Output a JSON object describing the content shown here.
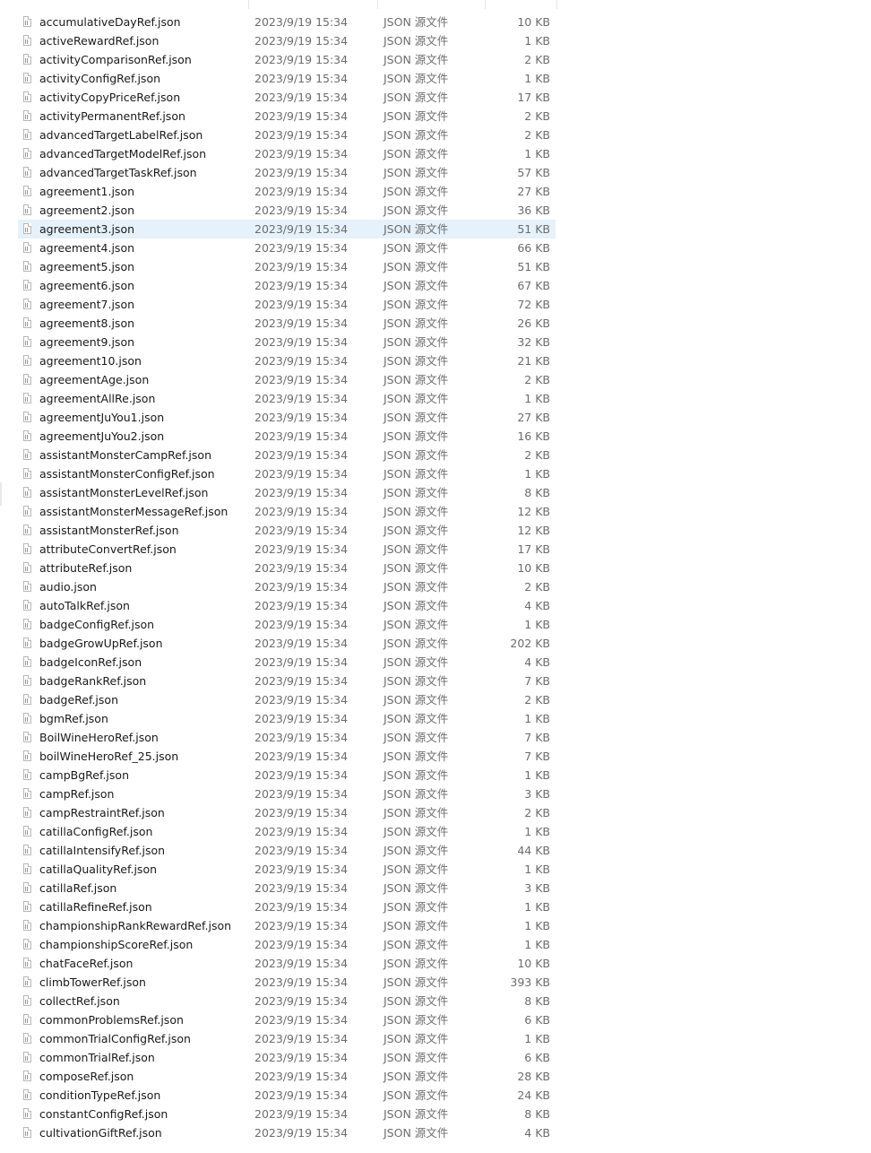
{
  "files": [
    {
      "name": "accumulativeDayRef.json",
      "date": "2023/9/19 15:34",
      "type": "JSON 源文件",
      "size": "10 KB"
    },
    {
      "name": "activeRewardRef.json",
      "date": "2023/9/19 15:34",
      "type": "JSON 源文件",
      "size": "1 KB"
    },
    {
      "name": "activityComparisonRef.json",
      "date": "2023/9/19 15:34",
      "type": "JSON 源文件",
      "size": "2 KB"
    },
    {
      "name": "activityConfigRef.json",
      "date": "2023/9/19 15:34",
      "type": "JSON 源文件",
      "size": "1 KB"
    },
    {
      "name": "activityCopyPriceRef.json",
      "date": "2023/9/19 15:34",
      "type": "JSON 源文件",
      "size": "17 KB"
    },
    {
      "name": "activityPermanentRef.json",
      "date": "2023/9/19 15:34",
      "type": "JSON 源文件",
      "size": "2 KB"
    },
    {
      "name": "advancedTargetLabelRef.json",
      "date": "2023/9/19 15:34",
      "type": "JSON 源文件",
      "size": "2 KB"
    },
    {
      "name": "advancedTargetModelRef.json",
      "date": "2023/9/19 15:34",
      "type": "JSON 源文件",
      "size": "1 KB"
    },
    {
      "name": "advancedTargetTaskRef.json",
      "date": "2023/9/19 15:34",
      "type": "JSON 源文件",
      "size": "57 KB"
    },
    {
      "name": "agreement1.json",
      "date": "2023/9/19 15:34",
      "type": "JSON 源文件",
      "size": "27 KB"
    },
    {
      "name": "agreement2.json",
      "date": "2023/9/19 15:34",
      "type": "JSON 源文件",
      "size": "36 KB"
    },
    {
      "name": "agreement3.json",
      "date": "2023/9/19 15:34",
      "type": "JSON 源文件",
      "size": "51 KB",
      "selected": true
    },
    {
      "name": "agreement4.json",
      "date": "2023/9/19 15:34",
      "type": "JSON 源文件",
      "size": "66 KB"
    },
    {
      "name": "agreement5.json",
      "date": "2023/9/19 15:34",
      "type": "JSON 源文件",
      "size": "51 KB"
    },
    {
      "name": "agreement6.json",
      "date": "2023/9/19 15:34",
      "type": "JSON 源文件",
      "size": "67 KB"
    },
    {
      "name": "agreement7.json",
      "date": "2023/9/19 15:34",
      "type": "JSON 源文件",
      "size": "72 KB"
    },
    {
      "name": "agreement8.json",
      "date": "2023/9/19 15:34",
      "type": "JSON 源文件",
      "size": "26 KB"
    },
    {
      "name": "agreement9.json",
      "date": "2023/9/19 15:34",
      "type": "JSON 源文件",
      "size": "32 KB"
    },
    {
      "name": "agreement10.json",
      "date": "2023/9/19 15:34",
      "type": "JSON 源文件",
      "size": "21 KB"
    },
    {
      "name": "agreementAge.json",
      "date": "2023/9/19 15:34",
      "type": "JSON 源文件",
      "size": "2 KB"
    },
    {
      "name": "agreementAllRe.json",
      "date": "2023/9/19 15:34",
      "type": "JSON 源文件",
      "size": "1 KB"
    },
    {
      "name": "agreementJuYou1.json",
      "date": "2023/9/19 15:34",
      "type": "JSON 源文件",
      "size": "27 KB"
    },
    {
      "name": "agreementJuYou2.json",
      "date": "2023/9/19 15:34",
      "type": "JSON 源文件",
      "size": "16 KB"
    },
    {
      "name": "assistantMonsterCampRef.json",
      "date": "2023/9/19 15:34",
      "type": "JSON 源文件",
      "size": "2 KB"
    },
    {
      "name": "assistantMonsterConfigRef.json",
      "date": "2023/9/19 15:34",
      "type": "JSON 源文件",
      "size": "1 KB"
    },
    {
      "name": "assistantMonsterLevelRef.json",
      "date": "2023/9/19 15:34",
      "type": "JSON 源文件",
      "size": "8 KB"
    },
    {
      "name": "assistantMonsterMessageRef.json",
      "date": "2023/9/19 15:34",
      "type": "JSON 源文件",
      "size": "12 KB"
    },
    {
      "name": "assistantMonsterRef.json",
      "date": "2023/9/19 15:34",
      "type": "JSON 源文件",
      "size": "12 KB"
    },
    {
      "name": "attributeConvertRef.json",
      "date": "2023/9/19 15:34",
      "type": "JSON 源文件",
      "size": "17 KB"
    },
    {
      "name": "attributeRef.json",
      "date": "2023/9/19 15:34",
      "type": "JSON 源文件",
      "size": "10 KB"
    },
    {
      "name": "audio.json",
      "date": "2023/9/19 15:34",
      "type": "JSON 源文件",
      "size": "2 KB"
    },
    {
      "name": "autoTalkRef.json",
      "date": "2023/9/19 15:34",
      "type": "JSON 源文件",
      "size": "4 KB"
    },
    {
      "name": "badgeConfigRef.json",
      "date": "2023/9/19 15:34",
      "type": "JSON 源文件",
      "size": "1 KB"
    },
    {
      "name": "badgeGrowUpRef.json",
      "date": "2023/9/19 15:34",
      "type": "JSON 源文件",
      "size": "202 KB"
    },
    {
      "name": "badgeIconRef.json",
      "date": "2023/9/19 15:34",
      "type": "JSON 源文件",
      "size": "4 KB"
    },
    {
      "name": "badgeRankRef.json",
      "date": "2023/9/19 15:34",
      "type": "JSON 源文件",
      "size": "7 KB"
    },
    {
      "name": "badgeRef.json",
      "date": "2023/9/19 15:34",
      "type": "JSON 源文件",
      "size": "2 KB"
    },
    {
      "name": "bgmRef.json",
      "date": "2023/9/19 15:34",
      "type": "JSON 源文件",
      "size": "1 KB"
    },
    {
      "name": "BoilWineHeroRef.json",
      "date": "2023/9/19 15:34",
      "type": "JSON 源文件",
      "size": "7 KB"
    },
    {
      "name": "boilWineHeroRef_25.json",
      "date": "2023/9/19 15:34",
      "type": "JSON 源文件",
      "size": "7 KB"
    },
    {
      "name": "campBgRef.json",
      "date": "2023/9/19 15:34",
      "type": "JSON 源文件",
      "size": "1 KB"
    },
    {
      "name": "campRef.json",
      "date": "2023/9/19 15:34",
      "type": "JSON 源文件",
      "size": "3 KB"
    },
    {
      "name": "campRestraintRef.json",
      "date": "2023/9/19 15:34",
      "type": "JSON 源文件",
      "size": "2 KB"
    },
    {
      "name": "catillaConfigRef.json",
      "date": "2023/9/19 15:34",
      "type": "JSON 源文件",
      "size": "1 KB"
    },
    {
      "name": "catillaIntensifyRef.json",
      "date": "2023/9/19 15:34",
      "type": "JSON 源文件",
      "size": "44 KB"
    },
    {
      "name": "catillaQualityRef.json",
      "date": "2023/9/19 15:34",
      "type": "JSON 源文件",
      "size": "1 KB"
    },
    {
      "name": "catillaRef.json",
      "date": "2023/9/19 15:34",
      "type": "JSON 源文件",
      "size": "3 KB"
    },
    {
      "name": "catillaRefineRef.json",
      "date": "2023/9/19 15:34",
      "type": "JSON 源文件",
      "size": "1 KB"
    },
    {
      "name": "championshipRankRewardRef.json",
      "date": "2023/9/19 15:34",
      "type": "JSON 源文件",
      "size": "1 KB"
    },
    {
      "name": "championshipScoreRef.json",
      "date": "2023/9/19 15:34",
      "type": "JSON 源文件",
      "size": "1 KB"
    },
    {
      "name": "chatFaceRef.json",
      "date": "2023/9/19 15:34",
      "type": "JSON 源文件",
      "size": "10 KB"
    },
    {
      "name": "climbTowerRef.json",
      "date": "2023/9/19 15:34",
      "type": "JSON 源文件",
      "size": "393 KB"
    },
    {
      "name": "collectRef.json",
      "date": "2023/9/19 15:34",
      "type": "JSON 源文件",
      "size": "8 KB"
    },
    {
      "name": "commonProblemsRef.json",
      "date": "2023/9/19 15:34",
      "type": "JSON 源文件",
      "size": "6 KB"
    },
    {
      "name": "commonTrialConfigRef.json",
      "date": "2023/9/19 15:34",
      "type": "JSON 源文件",
      "size": "1 KB"
    },
    {
      "name": "commonTrialRef.json",
      "date": "2023/9/19 15:34",
      "type": "JSON 源文件",
      "size": "6 KB"
    },
    {
      "name": "composeRef.json",
      "date": "2023/9/19 15:34",
      "type": "JSON 源文件",
      "size": "28 KB"
    },
    {
      "name": "conditionTypeRef.json",
      "date": "2023/9/19 15:34",
      "type": "JSON 源文件",
      "size": "24 KB"
    },
    {
      "name": "constantConfigRef.json",
      "date": "2023/9/19 15:34",
      "type": "JSON 源文件",
      "size": "8 KB"
    },
    {
      "name": "cultivationGiftRef.json",
      "date": "2023/9/19 15:34",
      "type": "JSON 源文件",
      "size": "4 KB"
    }
  ],
  "icons": {
    "file": "json-file-icon"
  },
  "colors": {
    "selected_row": "#e5f1fb",
    "secondary_text": "#6d6d6d",
    "primary_text": "#1a1a1a"
  }
}
